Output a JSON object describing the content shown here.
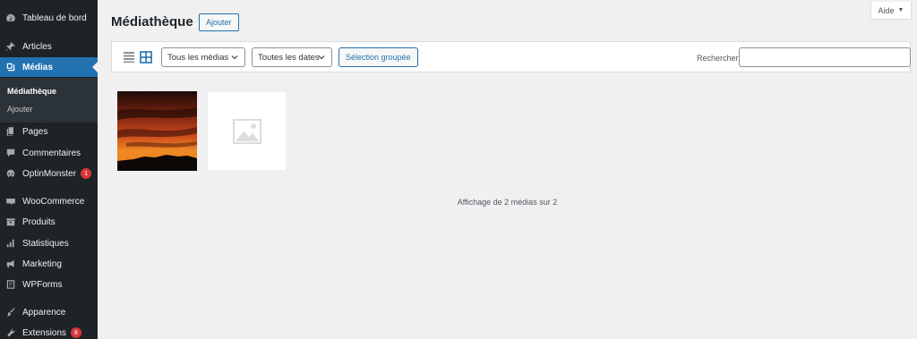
{
  "sidebar": {
    "items": [
      {
        "label": "Tableau de bord",
        "icon": "dashboard-icon"
      },
      {
        "label": "Articles",
        "icon": "pin-icon"
      },
      {
        "label": "Médias",
        "icon": "media-icon"
      },
      {
        "label": "Pages",
        "icon": "pages-icon"
      },
      {
        "label": "Commentaires",
        "icon": "comments-icon"
      },
      {
        "label": "OptinMonster",
        "icon": "optinmonster-icon",
        "badge": "1"
      },
      {
        "label": "WooCommerce",
        "icon": "woocommerce-icon"
      },
      {
        "label": "Produits",
        "icon": "products-icon"
      },
      {
        "label": "Statistiques",
        "icon": "stats-icon"
      },
      {
        "label": "Marketing",
        "icon": "megaphone-icon"
      },
      {
        "label": "WPForms",
        "icon": "wpforms-icon"
      },
      {
        "label": "Apparence",
        "icon": "brush-icon"
      },
      {
        "label": "Extensions",
        "icon": "plugin-icon",
        "badge": "8"
      }
    ],
    "submenu": [
      {
        "label": "Médiathèque",
        "current": true
      },
      {
        "label": "Ajouter",
        "current": false
      }
    ],
    "colors": {
      "background": "#1d2327",
      "active": "#2271b1",
      "badge": "#d63638"
    }
  },
  "header": {
    "title": "Médiathèque",
    "add_label": "Ajouter",
    "help_label": "Aide"
  },
  "toolbar": {
    "filter_type": "Tous les médias",
    "filter_date": "Toutes les dates",
    "bulk_label": "Sélection groupée",
    "search_label": "Rechercher",
    "search_value": ""
  },
  "media": {
    "items": [
      {
        "kind": "sunset-photo"
      },
      {
        "kind": "placeholder-image"
      }
    ],
    "count_text": "Affichage de 2 médias sur 2"
  }
}
